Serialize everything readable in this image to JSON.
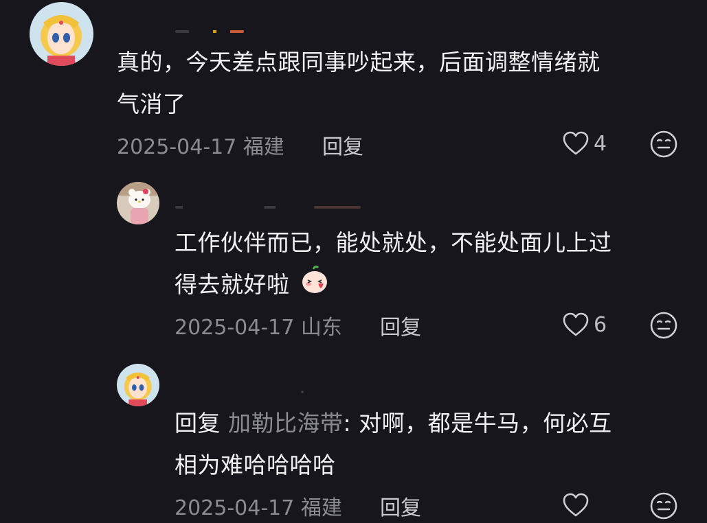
{
  "comments": [
    {
      "text": "真的，今天差点跟同事吵起来，后面调整情绪就气消了",
      "line1": "真的，今天差点跟同事吵起来，后面调整情绪就",
      "line2": "气消了",
      "date": "2025-04-17",
      "location": "福建",
      "reply_label": "回复",
      "likes": "4",
      "avatar_icon": "sailor-moon-avatar-icon"
    },
    {
      "text": "工作伙伴而已，能处就处，不能处面儿上过得去就好啦",
      "line1": "工作伙伴而已，能处就处，不能处面儿上过",
      "line2": "得去就好啦",
      "emoji_icon": "blushing-face-sticker-icon",
      "date": "2025-04-17",
      "location": "山东",
      "reply_label": "回复",
      "likes": "6",
      "avatar_icon": "hello-kitty-avatar-icon"
    },
    {
      "reply_prefix": "回复",
      "mention": "加勒比海带",
      "colon": ":",
      "line1_rest": "对啊，都是牛马，何必互",
      "line2": "相为难哈哈哈哈",
      "date": "2025-04-17",
      "location": "福建",
      "reply_label": "回复",
      "likes": "",
      "avatar_icon": "sailor-moon-avatar-icon"
    }
  ],
  "colors": {
    "background": "#16161c",
    "text": "#f1f1f3",
    "meta": "#8b8b92"
  }
}
